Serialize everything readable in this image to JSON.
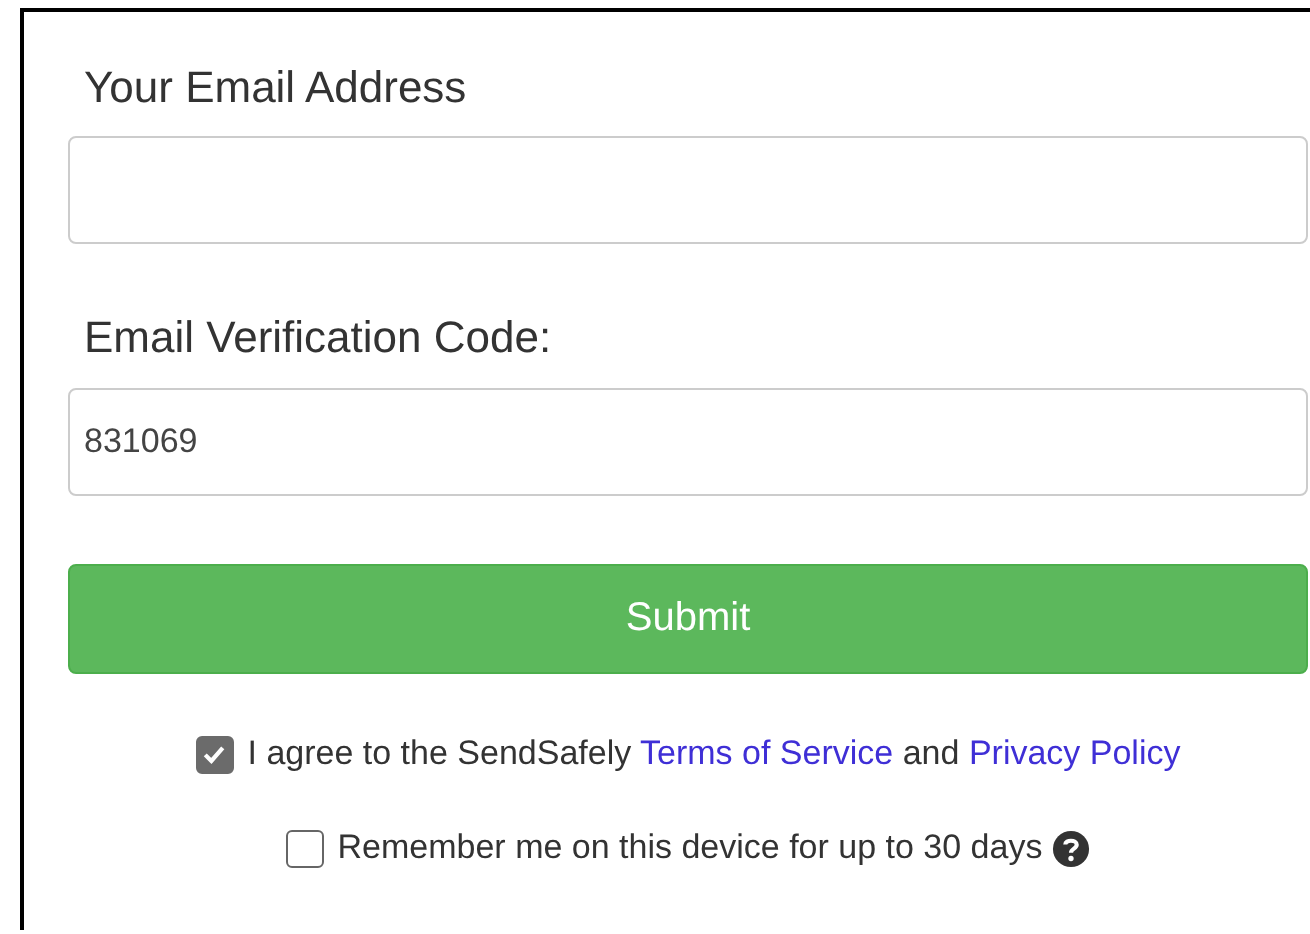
{
  "email_field": {
    "label": "Your Email Address"
  },
  "code_field": {
    "label": "Email Verification Code:",
    "value": "831069"
  },
  "submit_button": {
    "label": "Submit"
  },
  "agree": {
    "checked": true,
    "text_before": "I agree to the SendSafely",
    "terms_link": "Terms of Service",
    "text_middle": "and",
    "privacy_link": "Privacy Policy"
  },
  "remember": {
    "checked": false,
    "label": "Remember me on this device for up to 30 days"
  }
}
